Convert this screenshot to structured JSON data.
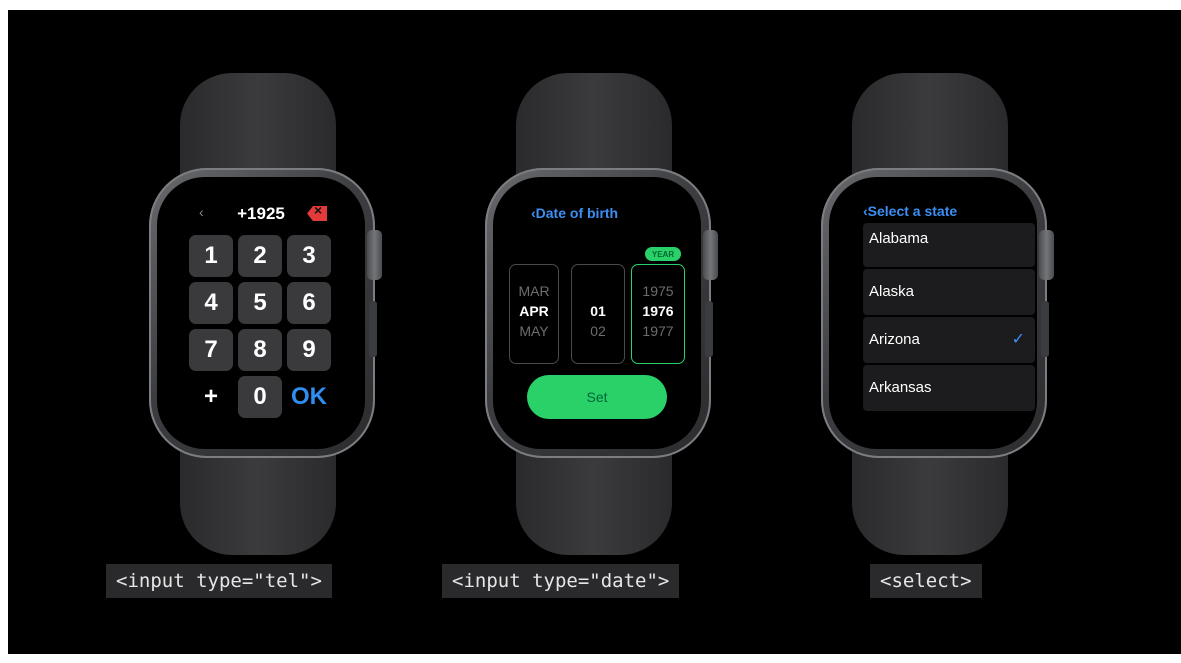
{
  "tel": {
    "back_icon": "‹",
    "number": "+1925",
    "keys": [
      "1",
      "2",
      "3",
      "4",
      "5",
      "6",
      "7",
      "8",
      "9",
      "+",
      "0",
      "OK"
    ],
    "caption": "<input type=\"tel\">"
  },
  "date": {
    "back_title": "‹Date of birth",
    "year_label": "YEAR",
    "month": {
      "prev": "MAR",
      "current": "APR",
      "next": "MAY"
    },
    "day": {
      "current": "01",
      "next": "02"
    },
    "year": {
      "prev": "1975",
      "current": "1976",
      "next": "1977"
    },
    "set_label": "Set",
    "caption": "<input type=\"date\">"
  },
  "select": {
    "back_title": "‹Select a state",
    "options": [
      "Alabama",
      "Alaska",
      "Arizona",
      "Arkansas"
    ],
    "selected_index": 2,
    "check_icon": "✓",
    "caption": "<select>"
  },
  "colors": {
    "accent_green": "#2ad169",
    "accent_blue": "#3d8ff3",
    "delete_red": "#e33b3b"
  }
}
